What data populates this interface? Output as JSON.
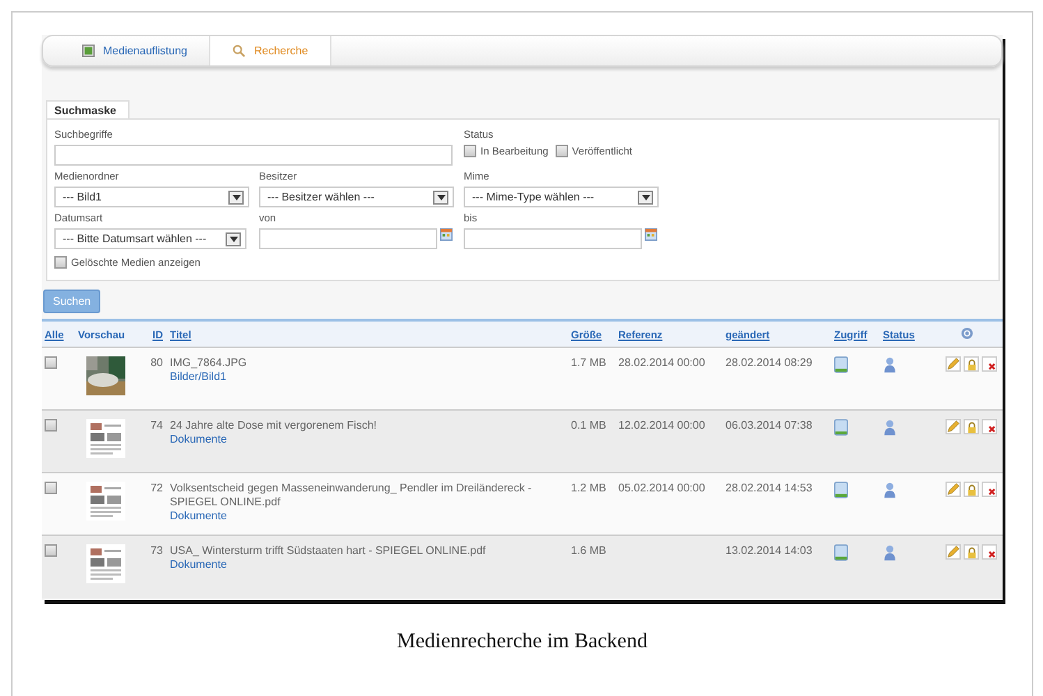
{
  "tabs": [
    {
      "label": "Medienauflistung",
      "kind": "list",
      "selected": false
    },
    {
      "label": "Recherche",
      "kind": "search",
      "selected": true
    }
  ],
  "search_form": {
    "legend": "Suchmaske",
    "keyword": {
      "label": "Suchbegriffe"
    },
    "status": {
      "label": "Status",
      "options": [
        {
          "label": "In Bearbeitung",
          "checked": false
        },
        {
          "label": "Veröffentlicht",
          "checked": false
        }
      ]
    },
    "selects": [
      {
        "label": "Medienordner",
        "value": "--- Bild1"
      },
      {
        "label": "Besitzer",
        "value": "--- Besitzer wählen ---"
      },
      {
        "label": "Mime",
        "value": "--- Mime-Type wählen ---"
      }
    ],
    "date_type": {
      "label": "Datumsart",
      "value": "--- Bitte Datumsart wählen ---"
    },
    "dates": [
      {
        "label": "von"
      },
      {
        "label": "bis"
      }
    ],
    "show_deleted": {
      "label": "Gelöschte Medien anzeigen",
      "checked": false
    }
  },
  "search_button": "Suchen",
  "table": {
    "columns": [
      {
        "label": "Alle",
        "link": true
      },
      {
        "label": "Vorschau",
        "link": false
      },
      {
        "label": "ID",
        "link": true
      },
      {
        "label": "Titel",
        "link": true
      },
      {
        "label": "Größe",
        "link": true
      },
      {
        "label": "Referenz",
        "link": true
      },
      {
        "label": "geändert",
        "link": true
      },
      {
        "label": "Zugriff",
        "link": true
      },
      {
        "label": "Status",
        "link": true
      }
    ],
    "rows": [
      {
        "checked": false,
        "id": "80",
        "title": "IMG_7864.JPG",
        "folder": "Bilder/Bild1",
        "size": "1.7 MB",
        "reference": "28.02.2014 00:00",
        "modified": "28.02.2014 08:29"
      },
      {
        "checked": false,
        "kind": "document",
        "id": "74",
        "title": "24 Jahre alte Dose mit vergorenem Fisch!",
        "folder": "Dokumente",
        "size": "0.1 MB",
        "reference": "12.02.2014 00:00",
        "modified": "06.03.2014 07:38"
      },
      {
        "checked": false,
        "kind": "document",
        "id": "72",
        "title": "Volksentscheid gegen Masseneinwanderung_ Pendler im Dreiländereck - SPIEGEL ONLINE.pdf",
        "folder": "Dokumente",
        "size": "1.2 MB",
        "reference": "05.02.2014 00:00",
        "modified": "28.02.2014 14:53"
      },
      {
        "checked": false,
        "kind": "document",
        "id": "73",
        "title": "USA_ Wintersturm trifft Südstaaten hart - SPIEGEL ONLINE.pdf",
        "folder": "Dokumente",
        "size": "1.6 MB",
        "modified": "13.02.2014 14:03"
      }
    ]
  },
  "caption": "Medienrecherche im Backend"
}
